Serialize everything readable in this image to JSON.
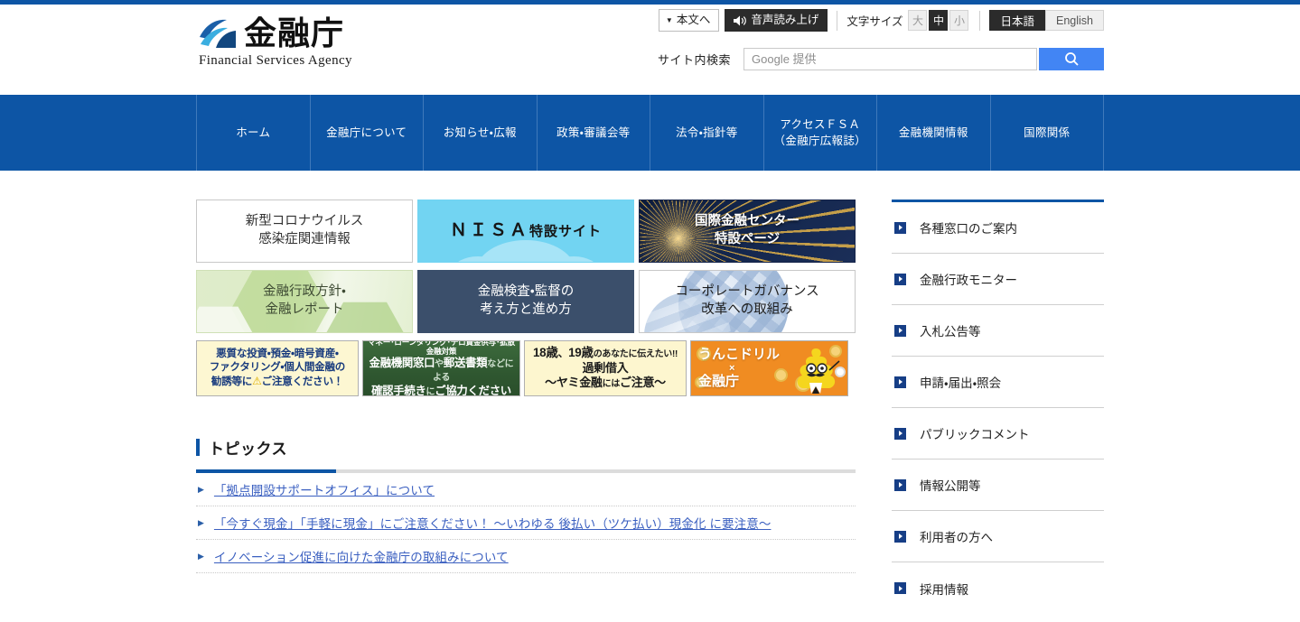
{
  "site": {
    "logo_jp": "金融庁",
    "logo_en": "Financial Services Agency"
  },
  "utility": {
    "jump_to_content": "本文へ",
    "speech": "音声読み上げ",
    "font_size_label": "文字サイズ",
    "font_sizes": [
      {
        "label": "大",
        "active": false
      },
      {
        "label": "中",
        "active": true
      },
      {
        "label": "小",
        "active": false
      }
    ],
    "lang": [
      {
        "label": "日本語",
        "active": true
      },
      {
        "label": "English",
        "active": false
      }
    ]
  },
  "search": {
    "label": "サイト内検索",
    "placeholder": "Google 提供",
    "value": "",
    "button_icon": "search-icon"
  },
  "gnav": {
    "items": [
      {
        "label": "ホーム"
      },
      {
        "label": "金融庁について"
      },
      {
        "label": "お知らせ・広報"
      },
      {
        "label": "政策・審議会等"
      },
      {
        "label": "法令・指針等"
      },
      {
        "label": "アクセスＦＳＡ",
        "label2": "（金融庁広報誌）"
      },
      {
        "label": "金融機関情報"
      },
      {
        "label": "国際関係"
      }
    ]
  },
  "banners": {
    "large": [
      {
        "line1": "新型コロナウイルス",
        "line2": "感染症関連情報"
      },
      {
        "line1": "ＮＩＳＡ",
        "line2": "特設サイト"
      },
      {
        "line1": "国際金融センター",
        "line2": "特設ページ"
      },
      {
        "line1": "金融行政方針・",
        "line2": "金融レポート"
      },
      {
        "line1": "金融検査・監督の",
        "line2": "考え方と進め方"
      },
      {
        "line1": "コーポレートガバナンス",
        "line2": "改革への取組み"
      }
    ],
    "small": {
      "warn": {
        "line1": "悪質な投資・預金・暗号資産・",
        "line2": "ファクタリング・個人間金融の",
        "line3a": "勧誘等に",
        "line3b": "ご注意ください！"
      },
      "aml": {
        "headline": "マネー･ローンダリング･テロ資金供与･拡散金融対策",
        "l2a": "金融機関窓口",
        "l2b": "や",
        "l2c": "郵送書類",
        "l2d": "などによる",
        "l3a": "確認手続き",
        "l3b": "に",
        "l3c": "ご協力ください"
      },
      "age": {
        "l1a": "18歳",
        "l1b": "、",
        "l1c": "19歳",
        "l1d": "のあなたに伝えたい!!",
        "l2a": "過剰借入",
        "l3a": "〜ヤミ金融",
        "l3b": "には",
        "l3c": "ご注意〜"
      },
      "unko": {
        "l1": "うんこドリル",
        "x": "×",
        "l2": "金融庁"
      }
    }
  },
  "topics": {
    "heading": "トピックス",
    "items": [
      {
        "label": "「拠点開設サポートオフィス」について"
      },
      {
        "label": "「今すぐ現金」「手軽に現金」にご注意ください！ 〜いわゆる 後払い（ツケ払い）現金化 に要注意〜"
      },
      {
        "label": "イノベーション促進に向けた金融庁の取組みについて"
      }
    ]
  },
  "sidebar": {
    "items": [
      {
        "label": "各種窓口のご案内"
      },
      {
        "label": "金融行政モニター"
      },
      {
        "label": "入札公告等"
      },
      {
        "label": "申請・届出・照会"
      },
      {
        "label": "パブリックコメント"
      },
      {
        "label": "情報公開等"
      },
      {
        "label": "利用者の方へ"
      },
      {
        "label": "採用情報"
      }
    ]
  },
  "colors": {
    "brand_blue": "#0d55a5",
    "dark": "#2b2b2b",
    "google_blue": "#4285f4",
    "link": "#3a5fc0"
  }
}
